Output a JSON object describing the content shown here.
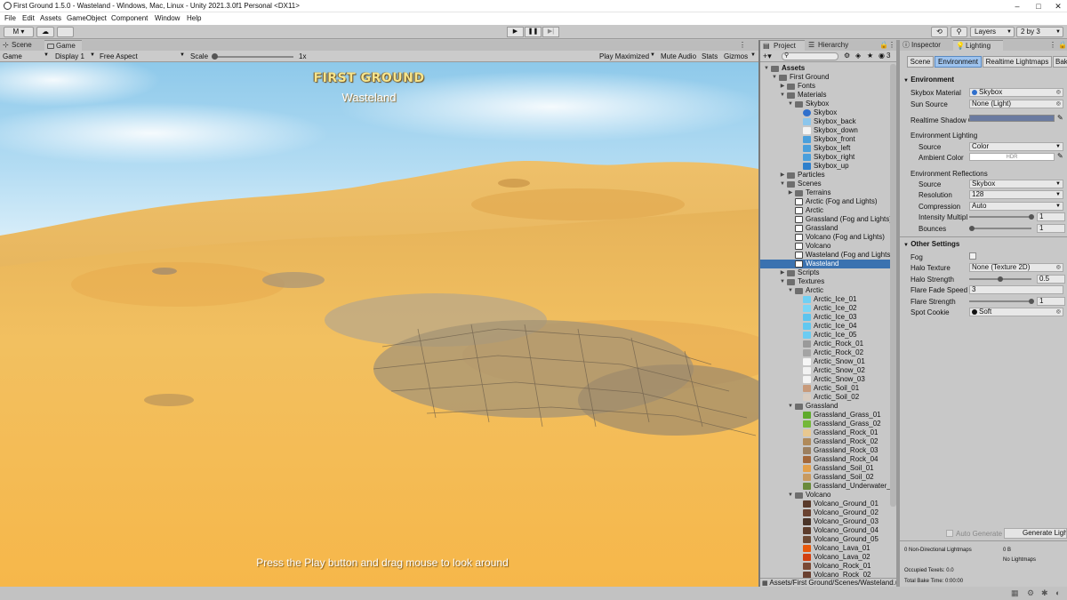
{
  "window": {
    "title": "First Ground 1.5.0 - Wasteland - Windows, Mac, Linux - Unity 2021.3.0f1 Personal <DX11>",
    "minimize": "–",
    "maximize": "□",
    "close": "✕"
  },
  "menu": [
    "File",
    "Edit",
    "Assets",
    "GameObject",
    "Component",
    "Window",
    "Help"
  ],
  "toolbar": {
    "account": "M",
    "play": "▶",
    "pause": "❚❚",
    "step": "▶|",
    "layers": "Layers",
    "layout": "2 by 3"
  },
  "game_panel": {
    "tabs": [
      "Scene",
      "Game"
    ],
    "active_tab": "Game",
    "mode": "Game",
    "display": "Display 1",
    "aspect": "Free Aspect",
    "scale_label": "Scale",
    "scale_value": "1x",
    "play_mode": "Play Maximized",
    "mute": "Mute Audio",
    "stats": "Stats",
    "gizmos": "Gizmos"
  },
  "game_view": {
    "title": "FIRST GROUND",
    "subtitle": "Wasteland",
    "hint": "Press the Play button and drag mouse to look around"
  },
  "project_panel": {
    "tabs": [
      "Project",
      "Hierarchy"
    ],
    "hidden_count": "3",
    "search_placeholder": "",
    "path": "Assets/First Ground/Scenes/Wasteland.u",
    "tree": [
      {
        "label": "Assets",
        "depth": 0,
        "icon": "folder",
        "expanded": true,
        "bold": true
      },
      {
        "label": "First Ground",
        "depth": 1,
        "icon": "folder",
        "expanded": true
      },
      {
        "label": "Fonts",
        "depth": 2,
        "icon": "folder",
        "expanded": false
      },
      {
        "label": "Materials",
        "depth": 2,
        "icon": "folder",
        "expanded": true
      },
      {
        "label": "Skybox",
        "depth": 3,
        "icon": "folder",
        "expanded": true
      },
      {
        "label": "Skybox",
        "depth": 4,
        "icon": "sphere",
        "color": "#2f6fcc"
      },
      {
        "label": "Skybox_back",
        "depth": 4,
        "icon": "tex",
        "color": "#8cc6ec"
      },
      {
        "label": "Skybox_down",
        "depth": 4,
        "icon": "tex",
        "color": "#f4f4f4"
      },
      {
        "label": "Skybox_front",
        "depth": 4,
        "icon": "tex",
        "color": "#4a9fdc"
      },
      {
        "label": "Skybox_left",
        "depth": 4,
        "icon": "tex",
        "color": "#4a9fdc"
      },
      {
        "label": "Skybox_right",
        "depth": 4,
        "icon": "tex",
        "color": "#4a9fdc"
      },
      {
        "label": "Skybox_up",
        "depth": 4,
        "icon": "tex",
        "color": "#2f80cc"
      },
      {
        "label": "Particles",
        "depth": 2,
        "icon": "folder",
        "expanded": false
      },
      {
        "label": "Scenes",
        "depth": 2,
        "icon": "folder",
        "expanded": true
      },
      {
        "label": "Terrains",
        "depth": 3,
        "icon": "folder",
        "expanded": false
      },
      {
        "label": "Arctic (Fog and Lights)",
        "depth": 3,
        "icon": "scene"
      },
      {
        "label": "Arctic",
        "depth": 3,
        "icon": "scene"
      },
      {
        "label": "Grassland (Fog and Lights)",
        "depth": 3,
        "icon": "scene"
      },
      {
        "label": "Grassland",
        "depth": 3,
        "icon": "scene"
      },
      {
        "label": "Volcano (Fog and Lights)",
        "depth": 3,
        "icon": "scene"
      },
      {
        "label": "Volcano",
        "depth": 3,
        "icon": "scene"
      },
      {
        "label": "Wasteland (Fog and Lights)",
        "depth": 3,
        "icon": "scene"
      },
      {
        "label": "Wasteland",
        "depth": 3,
        "icon": "scene",
        "selected": true
      },
      {
        "label": "Scripts",
        "depth": 2,
        "icon": "folder",
        "expanded": false
      },
      {
        "label": "Textures",
        "depth": 2,
        "icon": "folder",
        "expanded": true
      },
      {
        "label": "Arctic",
        "depth": 3,
        "icon": "folder",
        "expanded": true
      },
      {
        "label": "Arctic_Ice_01",
        "depth": 4,
        "icon": "tex",
        "color": "#6fd0f4"
      },
      {
        "label": "Arctic_Ice_02",
        "depth": 4,
        "icon": "tex",
        "color": "#7ad6f6"
      },
      {
        "label": "Arctic_Ice_03",
        "depth": 4,
        "icon": "tex",
        "color": "#5cc4ee"
      },
      {
        "label": "Arctic_Ice_04",
        "depth": 4,
        "icon": "tex",
        "color": "#62c8f0"
      },
      {
        "label": "Arctic_Ice_05",
        "depth": 4,
        "icon": "tex",
        "color": "#6cccf2"
      },
      {
        "label": "Arctic_Rock_01",
        "depth": 4,
        "icon": "tex",
        "color": "#9a9a9a"
      },
      {
        "label": "Arctic_Rock_02",
        "depth": 4,
        "icon": "tex",
        "color": "#a4a4a4"
      },
      {
        "label": "Arctic_Snow_01",
        "depth": 4,
        "icon": "tex",
        "color": "#f6f6f6"
      },
      {
        "label": "Arctic_Snow_02",
        "depth": 4,
        "icon": "tex",
        "color": "#f2f2f2"
      },
      {
        "label": "Arctic_Snow_03",
        "depth": 4,
        "icon": "tex",
        "color": "#f4f4f4"
      },
      {
        "label": "Arctic_Soil_01",
        "depth": 4,
        "icon": "tex",
        "color": "#c89a7a"
      },
      {
        "label": "Arctic_Soil_02",
        "depth": 4,
        "icon": "tex",
        "color": "#d8ccc0"
      },
      {
        "label": "Grassland",
        "depth": 3,
        "icon": "folder",
        "expanded": true
      },
      {
        "label": "Grassland_Grass_01",
        "depth": 4,
        "icon": "tex",
        "color": "#5faa2c"
      },
      {
        "label": "Grassland_Grass_02",
        "depth": 4,
        "icon": "tex",
        "color": "#74b83a"
      },
      {
        "label": "Grassland_Rock_01",
        "depth": 4,
        "icon": "tex",
        "color": "#e8c890"
      },
      {
        "label": "Grassland_Rock_02",
        "depth": 4,
        "icon": "tex",
        "color": "#b08a5a"
      },
      {
        "label": "Grassland_Rock_03",
        "depth": 4,
        "icon": "tex",
        "color": "#9c8060"
      },
      {
        "label": "Grassland_Rock_04",
        "depth": 4,
        "icon": "tex",
        "color": "#a4683a"
      },
      {
        "label": "Grassland_Soil_01",
        "depth": 4,
        "icon": "tex",
        "color": "#e4a04a"
      },
      {
        "label": "Grassland_Soil_02",
        "depth": 4,
        "icon": "tex",
        "color": "#c89a60"
      },
      {
        "label": "Grassland_Underwater_01",
        "depth": 4,
        "icon": "tex",
        "color": "#6a8a3a"
      },
      {
        "label": "Volcano",
        "depth": 3,
        "icon": "folder",
        "expanded": true
      },
      {
        "label": "Volcano_Ground_01",
        "depth": 4,
        "icon": "tex",
        "color": "#5a3a2a"
      },
      {
        "label": "Volcano_Ground_02",
        "depth": 4,
        "icon": "tex",
        "color": "#6a4230"
      },
      {
        "label": "Volcano_Ground_03",
        "depth": 4,
        "icon": "tex",
        "color": "#4a3428"
      },
      {
        "label": "Volcano_Ground_04",
        "depth": 4,
        "icon": "tex",
        "color": "#5c3c2c"
      },
      {
        "label": "Volcano_Ground_05",
        "depth": 4,
        "icon": "tex",
        "color": "#6e4a34"
      },
      {
        "label": "Volcano_Lava_01",
        "depth": 4,
        "icon": "tex",
        "color": "#e8580a"
      },
      {
        "label": "Volcano_Lava_02",
        "depth": 4,
        "icon": "tex",
        "color": "#d24010"
      },
      {
        "label": "Volcano_Rock_01",
        "depth": 4,
        "icon": "tex",
        "color": "#7a4a36"
      },
      {
        "label": "Volcano_Rock_02",
        "depth": 4,
        "icon": "tex",
        "color": "#6a4030"
      }
    ]
  },
  "inspector_panel": {
    "tabs": [
      "Inspector",
      "Lighting"
    ],
    "active_tab": "Lighting",
    "lighting_tabs": [
      "Scene",
      "Environment",
      "Realtime Lightmaps",
      "Bake"
    ],
    "active_lighting_tab": "Environment",
    "environment": {
      "header": "Environment",
      "skybox_material_label": "Skybox Material",
      "skybox_material_value": "Skybox",
      "sun_source_label": "Sun Source",
      "sun_source_value": "None (Light)",
      "realtime_shadow_label": "Realtime Shadow C",
      "realtime_shadow_color": "#6a7aa0",
      "env_lighting_header": "Environment Lighting",
      "source_label": "Source",
      "source_value": "Color",
      "ambient_label": "Ambient Color",
      "ambient_value": "HDR",
      "env_reflections_header": "Environment Reflections",
      "refl_source_label": "Source",
      "refl_source_value": "Skybox",
      "resolution_label": "Resolution",
      "resolution_value": "128",
      "compression_label": "Compression",
      "compression_value": "Auto",
      "intensity_label": "Intensity Multipl",
      "intensity_value": "1",
      "bounces_label": "Bounces",
      "bounces_value": "1"
    },
    "other": {
      "header": "Other Settings",
      "fog_label": "Fog",
      "halo_texture_label": "Halo Texture",
      "halo_texture_value": "None (Texture 2D)",
      "halo_strength_label": "Halo Strength",
      "halo_strength_value": "0.5",
      "flare_fade_label": "Flare Fade Speed",
      "flare_fade_value": "3",
      "flare_strength_label": "Flare Strength",
      "flare_strength_value": "1",
      "spot_cookie_label": "Spot Cookie",
      "spot_cookie_value": "Soft"
    },
    "bottom": {
      "auto_generate": "Auto Generate",
      "generate": "Generate Ligh",
      "lightmaps_count": "0 Non-Directional Lightmaps",
      "lightmaps_size": "0 B",
      "no_lightmaps": "No Lightmaps",
      "occupied_texels": "Occupied Texels: 0.0",
      "total_bake_time": "Total Bake Time: 0:00:00"
    }
  },
  "colors": {
    "accent": "#3a72b0",
    "sky_top": "#8ec9ea",
    "sand": "#f2c060"
  }
}
